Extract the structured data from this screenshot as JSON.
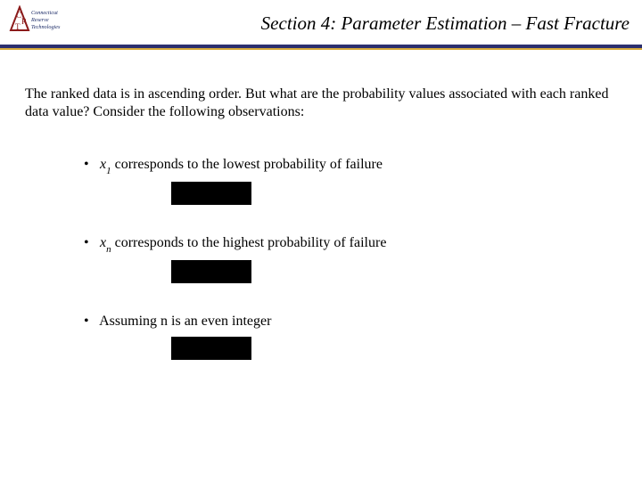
{
  "header": {
    "title": "Section 4: Parameter Estimation – Fast Fracture",
    "logo": {
      "brand_top": "Connecticut",
      "brand_mid": "Reserve",
      "brand_bot": "Technologies",
      "triangle_letters": [
        "C",
        "R",
        "T"
      ]
    },
    "colors": {
      "rule_primary": "#2b2f6f",
      "rule_accent": "#d6a93a"
    }
  },
  "intro": "The ranked data is in ascending order.  But what are the probability values associated with each ranked data value?  Consider the following observations:",
  "bullets": [
    {
      "pre": "",
      "var": "x",
      "sub": "1",
      "post": " corresponds to the lowest probability of failure"
    },
    {
      "pre": "",
      "var": "x",
      "sub": "n",
      "post": " corresponds to the highest probability of failure"
    },
    {
      "pre": "Assuming n is an even integer",
      "var": "",
      "sub": "",
      "post": ""
    }
  ]
}
